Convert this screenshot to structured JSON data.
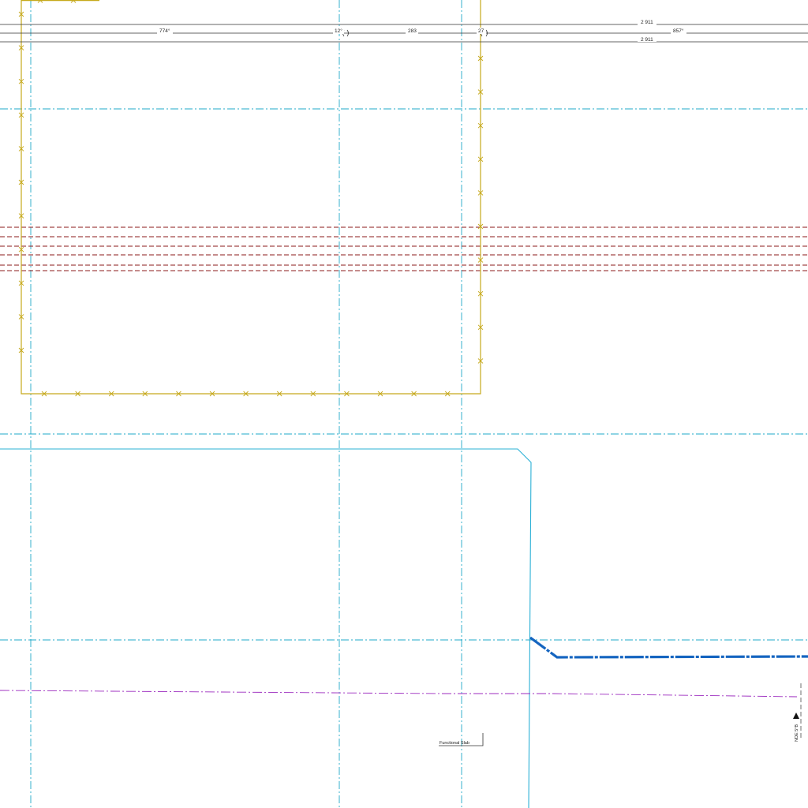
{
  "colors": {
    "background": "#ffffff",
    "dimension_line": "#333333",
    "grid_line": "#1fa9c9",
    "boundary": "#c6a91c",
    "easement": "#8b1a1a",
    "pipe_thin": "#2bb0d6",
    "pipe_main": "#1565c0",
    "reference_line": "#9c2bbf",
    "label": "#222222"
  },
  "dimensions": {
    "top": "2 911",
    "span_1": "774°",
    "span_2": "12°",
    "span_3": "283",
    "span_4": "27",
    "span_5": "857°",
    "bottom": "2 911"
  },
  "labels": {
    "callout": "Functional Slab",
    "side_marker": "NDE 5°B"
  },
  "icons": {
    "boundary_marker": "x-marker-icon",
    "north_marker": "triangle-icon"
  }
}
